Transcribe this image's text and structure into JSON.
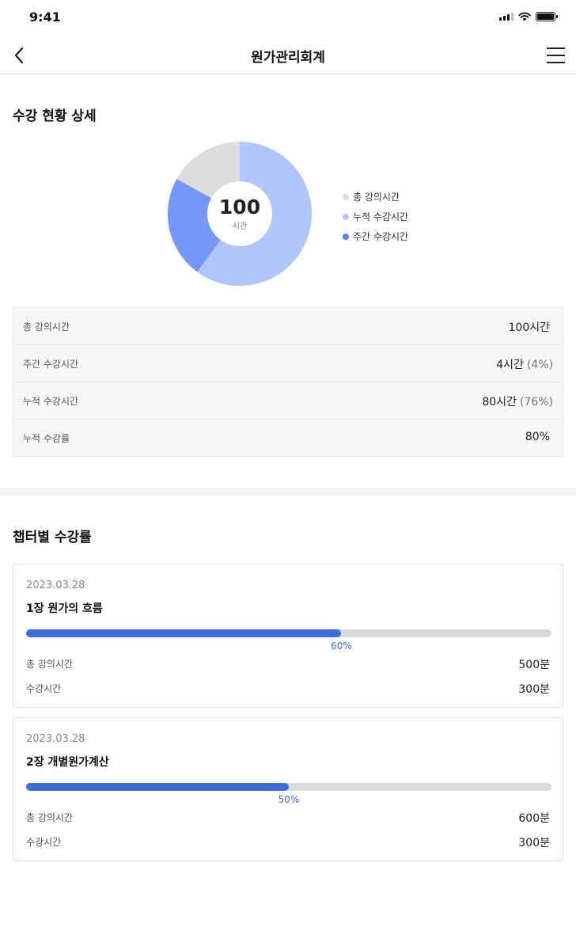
{
  "status_bar": {
    "time": "9:41"
  },
  "header": {
    "title": "원가관리회계"
  },
  "summary": {
    "section_title": "수강 현황 상세",
    "donut": {
      "center_value": "100",
      "center_unit": "시간",
      "segments": [
        {
          "name": "누적 수강시간",
          "percent": 60,
          "color": "#b0c5fb"
        },
        {
          "name": "주간 수강시간",
          "percent": 23,
          "color": "#7497f8"
        },
        {
          "name": "총 강의시간",
          "percent": 17,
          "color": "#dcdcdc"
        }
      ]
    },
    "legend": [
      {
        "label": "총 강의시간",
        "color": "#dcdcdc"
      },
      {
        "label": "누적 수강시간",
        "color": "#b0c5fb"
      },
      {
        "label": "주간 수강시간",
        "color": "#5a83f5"
      }
    ],
    "rows": [
      {
        "label": "총 강의시간",
        "value": "100시간",
        "pct": ""
      },
      {
        "label": "주간 수강시간",
        "value": "4시간",
        "pct": "(4%)"
      },
      {
        "label": "누적 수강시간",
        "value": "80시간",
        "pct": "(76%)"
      },
      {
        "label": "누적 수강률",
        "value": "80%",
        "pct": ""
      }
    ]
  },
  "chapters": {
    "section_title": "챕터별 수강률",
    "items": [
      {
        "date": "2023.03.28",
        "title": "1장 원가의 흐름",
        "progress": 60,
        "progress_label": "60%",
        "total_label": "총 강의시간",
        "total_value": "500분",
        "watched_label": "수강시간",
        "watched_value": "300분"
      },
      {
        "date": "2023.03.28",
        "title": "2장 개별원가계산",
        "progress": 50,
        "progress_label": "50%",
        "total_label": "총 강의시간",
        "total_value": "600분",
        "watched_label": "수강시간",
        "watched_value": "300분"
      }
    ]
  },
  "colors": {
    "accent": "#3f6ddc",
    "track": "#d9d9d9"
  }
}
